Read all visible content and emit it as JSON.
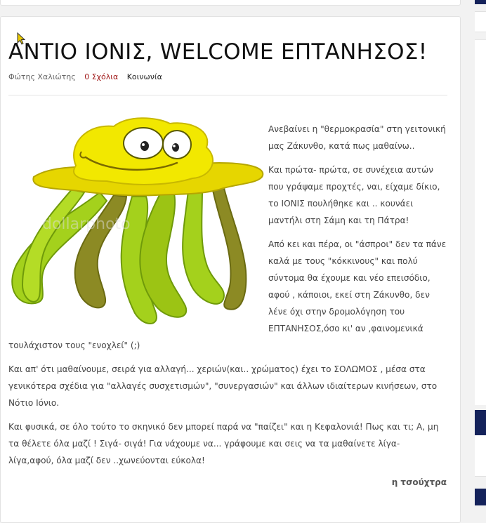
{
  "post": {
    "title": "ΑΝΤΙΟ ΙΟΝΙΣ, WELCOME ΕΠΤΑΝΗΣΟΣ!",
    "author": "Φώτης Χαλιώτης",
    "comments": "0 Σχόλια",
    "category": "Κοινωνία",
    "paragraphs": [
      "Ανεβαίνει η \"θερμοκρασία\" στη γειτονική μας Ζάκυνθο, κατά πως μαθαίνω..",
      "Και πρώτα- πρώτα, σε συνέχεια αυτών που γράψαμε προχτές, ναι, είχαμε δίκιο, το ΙΟΝΙΣ πουλήθηκε και .. κουνάει μαντήλι στη Σάμη και τη Πάτρα!",
      "Από κει και πέρα, οι \"άσπροι\" δεν τα πάνε καλά με τους \"κόκκινους\" και πολύ σύντομα θα έχουμε και νέο επεισόδιο, αφού , κάποιοι, εκεί στη Ζάκυνθο, δεν λένε όχι στην δρομολόγηση του ΕΠΤΑΝΗΣΟΣ,όσο κι' αν ,φαινομενικά τουλάχιστον τους \"ενοχλεί\" (;)",
      "Και απ' ότι μαθαίνουμε, σειρά για αλλαγή... χεριών(και.. χρώματος)  έχει το ΣΟΛΩΜΟΣ , μέσα στα γενικότερα σχέδια για \"αλλαγές συσχετισμών\", \"συνεργασιών\" και άλλων ιδιαίτερων κινήσεων, στο Νότιο Ιόνιο.",
      "Και φυσικά, σε όλο τούτο το σκηνικό δεν μπορεί παρά να \"παίζει\" και η Κεφαλονιά!  Πως και τι; Α, μη τα θέλετε όλα μαζί ! Σιγά- σιγά! Για νάχουμε να... γράφουμε και σεις να τα μαθαίνετε λίγα- λίγα,αφού, όλα μαζί δεν ..χωνεύονται εύκολα!"
    ],
    "signature": "η τσούχτρα",
    "image_watermark": "dollarphoto"
  },
  "colors": {
    "accent": "#a01818",
    "sidebar_navy": "#14225a",
    "jelly_yellow": "#f2e800",
    "tentacle_green": "#9ccc18"
  }
}
